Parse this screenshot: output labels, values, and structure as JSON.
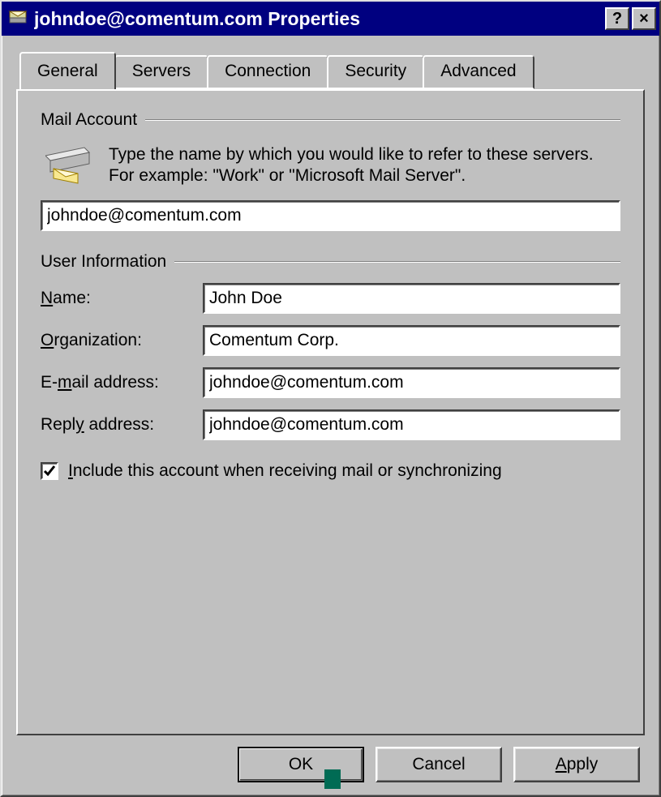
{
  "title": "johndoe@comentum.com Properties",
  "titlebar_buttons": {
    "help": "?",
    "close": "×"
  },
  "tabs": [
    {
      "label": "General",
      "active": true
    },
    {
      "label": "Servers",
      "active": false
    },
    {
      "label": "Connection",
      "active": false
    },
    {
      "label": "Security",
      "active": false
    },
    {
      "label": "Advanced",
      "active": false
    }
  ],
  "mail_account": {
    "legend": "Mail Account",
    "instruction": "Type the name by which you would like to refer to these servers.  For example: \"Work\" or \"Microsoft Mail Server\".",
    "value": "johndoe@comentum.com"
  },
  "user_info": {
    "legend": "User Information",
    "fields": {
      "name": {
        "label_pre": "",
        "label_u": "N",
        "label_post": "ame:",
        "value": "John Doe"
      },
      "org": {
        "label_pre": "",
        "label_u": "O",
        "label_post": "rganization:",
        "value": "Comentum Corp."
      },
      "email": {
        "label_pre": "E-",
        "label_u": "m",
        "label_post": "ail address:",
        "value": "johndoe@comentum.com"
      },
      "reply": {
        "label_pre": "Repl",
        "label_u": "y",
        "label_post": " address:",
        "value": "johndoe@comentum.com"
      }
    }
  },
  "include_checkbox": {
    "checked": true,
    "label_pre": "",
    "label_u": "I",
    "label_post": "nclude this account when receiving mail or synchronizing"
  },
  "buttons": {
    "ok": {
      "label": "OK"
    },
    "cancel": {
      "label": "Cancel"
    },
    "apply": {
      "label_pre": "",
      "label_u": "A",
      "label_post": "pply"
    }
  }
}
